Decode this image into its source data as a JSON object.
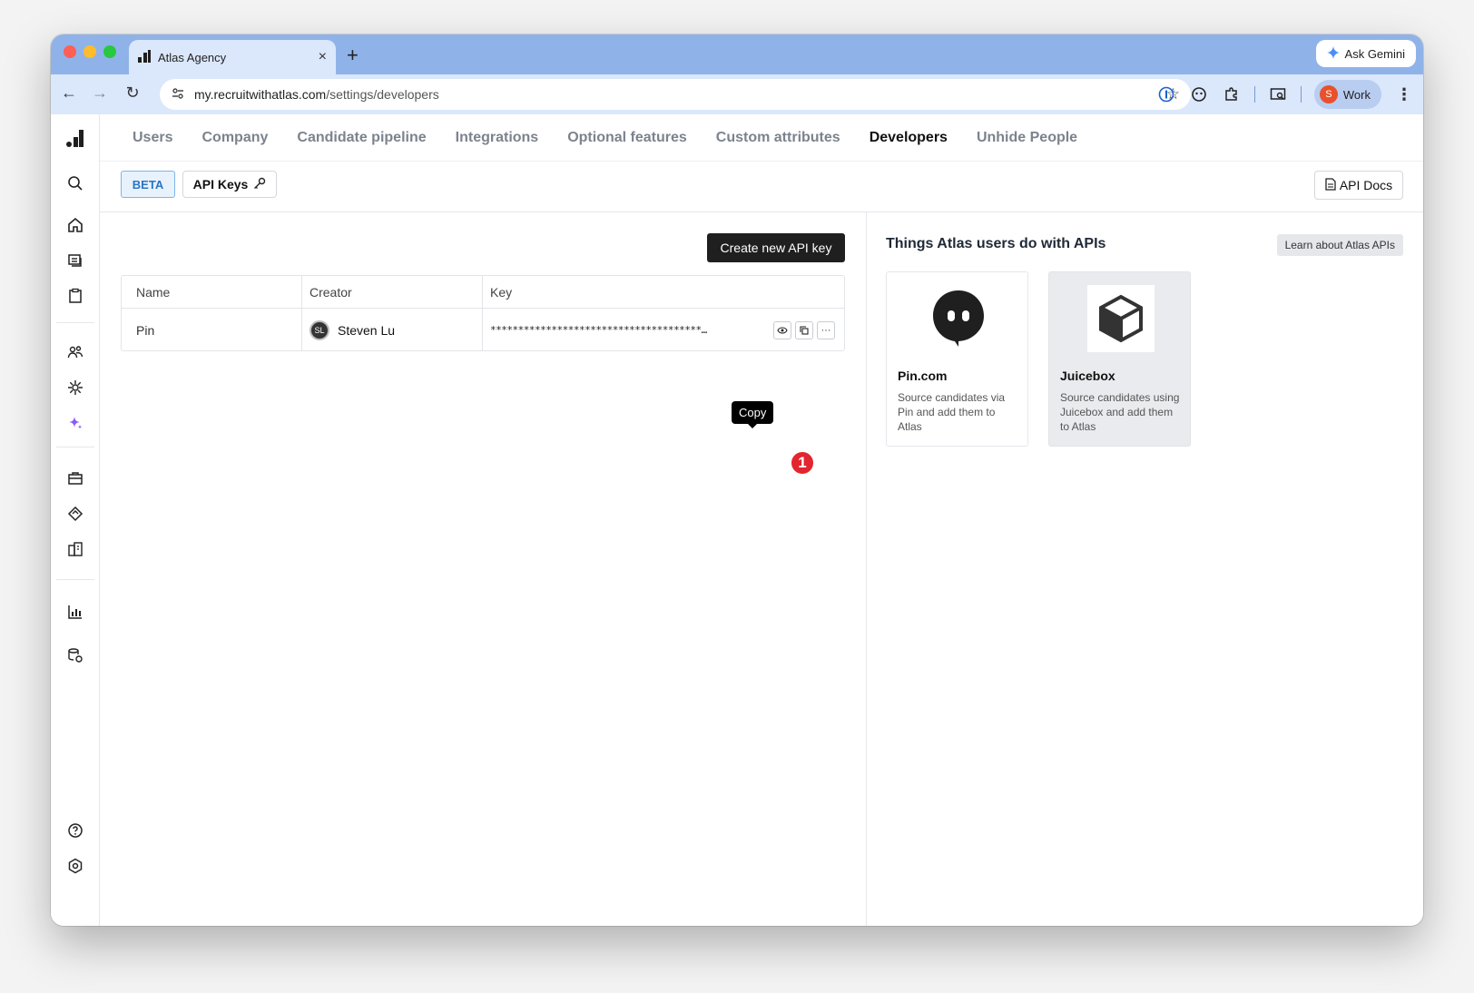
{
  "browser": {
    "tab_title": "Atlas Agency",
    "new_tab": "+",
    "tab_close": "×",
    "gemini_label": "Ask Gemini",
    "url_host": "my.recruitwithatlas.com",
    "url_path": "/settings/developers",
    "profile_initial": "S",
    "profile_label": "Work"
  },
  "nav": {
    "items": [
      "Users",
      "Company",
      "Candidate pipeline",
      "Integrations",
      "Optional features",
      "Custom attributes",
      "Developers",
      "Unhide People"
    ],
    "active_index": 6
  },
  "subbar": {
    "beta": "BETA",
    "api_keys": "API Keys",
    "api_docs": "API Docs"
  },
  "keys": {
    "create_button": "Create new API key",
    "columns": [
      "Name",
      "Creator",
      "Key"
    ],
    "rows": [
      {
        "name": "Pin",
        "creator_initials": "SL",
        "creator": "Steven Lu",
        "key": "**************************************…"
      }
    ],
    "tooltip": "Copy",
    "marker": "1"
  },
  "apis": {
    "title": "Things Atlas users do with APIs",
    "learn_button": "Learn about Atlas APIs",
    "cards": [
      {
        "name": "Pin.com",
        "desc": "Source candidates via Pin and add them to Atlas"
      },
      {
        "name": "Juicebox",
        "desc": "Source candidates using Juicebox and add them to Atlas"
      }
    ]
  },
  "colors": {
    "titlebar": "#8fb3e8",
    "toolbar": "#dbe7fb",
    "accent_beta": "#2a75c4",
    "marker": "#e3252f"
  }
}
